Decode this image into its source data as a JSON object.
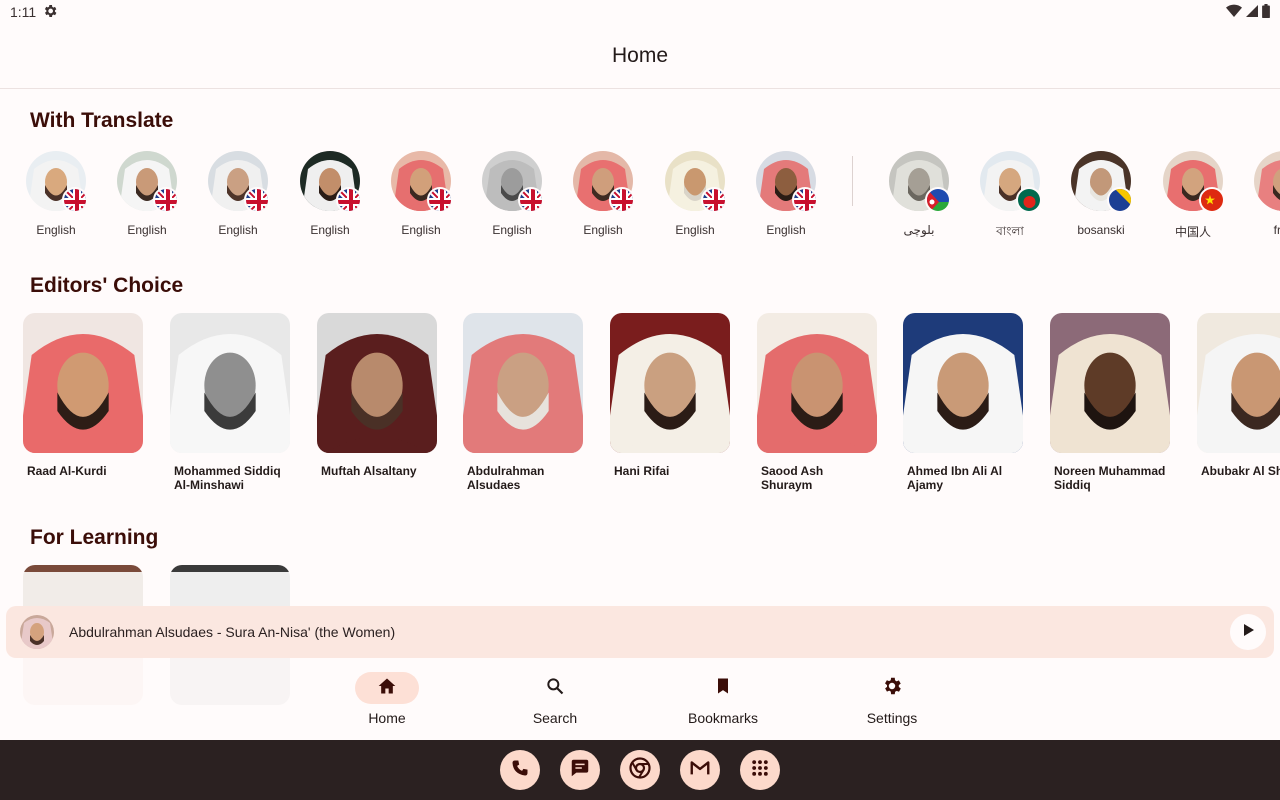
{
  "status_bar": {
    "time": "1:11",
    "settings_icon": "gear-icon",
    "wifi_icon": "wifi-icon",
    "signal_icon": "signal-icon",
    "battery_icon": "battery-icon"
  },
  "header": {
    "title": "Home"
  },
  "sections": {
    "with_translate": "With Translate",
    "editors_choice": "Editors' Choice",
    "for_learning": "For Learning"
  },
  "translate_items": [
    {
      "label": "English",
      "flag": "uk"
    },
    {
      "label": "English",
      "flag": "uk"
    },
    {
      "label": "English",
      "flag": "uk"
    },
    {
      "label": "English",
      "flag": "uk"
    },
    {
      "label": "English",
      "flag": "uk"
    },
    {
      "label": "English",
      "flag": "uk"
    },
    {
      "label": "English",
      "flag": "uk"
    },
    {
      "label": "English",
      "flag": "uk"
    },
    {
      "label": "English",
      "flag": "uk"
    },
    {
      "label": "بلوچی",
      "flag": "balochistan"
    },
    {
      "label": "বাংলা",
      "flag": "bangladesh"
    },
    {
      "label": "bosanski",
      "flag": "bosnia"
    },
    {
      "label": "中国人",
      "flag": "china"
    },
    {
      "label": "fran",
      "flag": "france"
    }
  ],
  "editors_choice": [
    {
      "name": "Raad Al-Kurdi"
    },
    {
      "name": "Mohammed Siddiq Al-Minshawi"
    },
    {
      "name": "Muftah Alsaltany"
    },
    {
      "name": "Abdulrahman Alsudaes"
    },
    {
      "name": "Hani Rifai"
    },
    {
      "name": "Saood Ash Shuraym"
    },
    {
      "name": "Ahmed Ibn Ali Al Ajamy"
    },
    {
      "name": "Noreen Muhammad Siddiq"
    },
    {
      "name": "Abubakr Al Sha"
    }
  ],
  "now_playing": {
    "title": "Abdulrahman Alsudaes - Sura An-Nisa' (the Women)",
    "play_icon": "play-icon"
  },
  "bottom_nav": [
    {
      "label": "Home",
      "icon": "home-icon",
      "active": true
    },
    {
      "label": "Search",
      "icon": "search-icon",
      "active": false
    },
    {
      "label": "Bookmarks",
      "icon": "bookmark-icon",
      "active": false
    },
    {
      "label": "Settings",
      "icon": "gear-icon",
      "active": false
    }
  ],
  "dock": [
    "phone-icon",
    "messages-icon",
    "chrome-icon",
    "gmail-icon",
    "apps-icon"
  ],
  "colors": {
    "accent": "#fde0d6",
    "title": "#3b0d08",
    "player_bg": "#fbe7e0",
    "taskbar": "#2b2121",
    "dock_btn": "#fcd9cb"
  }
}
